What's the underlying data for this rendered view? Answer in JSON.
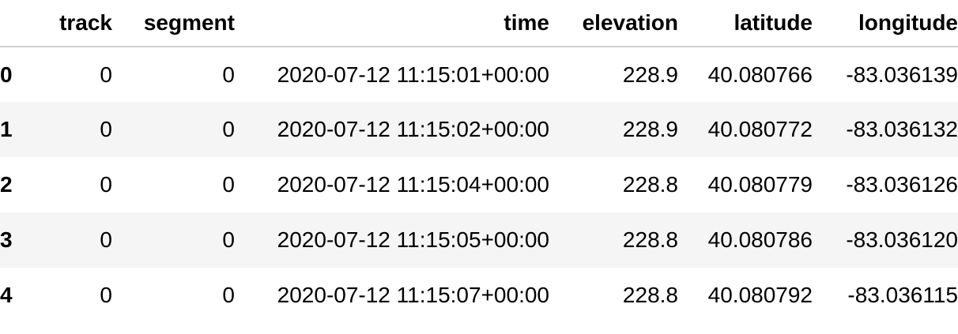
{
  "table": {
    "columns": [
      "",
      "track",
      "segment",
      "time",
      "elevation",
      "latitude",
      "longitude"
    ],
    "rows": [
      {
        "index": "0",
        "track": "0",
        "segment": "0",
        "time": "2020-07-12 11:15:01+00:00",
        "elevation": "228.9",
        "latitude": "40.080766",
        "longitude": "-83.036139"
      },
      {
        "index": "1",
        "track": "0",
        "segment": "0",
        "time": "2020-07-12 11:15:02+00:00",
        "elevation": "228.9",
        "latitude": "40.080772",
        "longitude": "-83.036132"
      },
      {
        "index": "2",
        "track": "0",
        "segment": "0",
        "time": "2020-07-12 11:15:04+00:00",
        "elevation": "228.8",
        "latitude": "40.080779",
        "longitude": "-83.036126"
      },
      {
        "index": "3",
        "track": "0",
        "segment": "0",
        "time": "2020-07-12 11:15:05+00:00",
        "elevation": "228.8",
        "latitude": "40.080786",
        "longitude": "-83.036120"
      },
      {
        "index": "4",
        "track": "0",
        "segment": "0",
        "time": "2020-07-12 11:15:07+00:00",
        "elevation": "228.8",
        "latitude": "40.080792",
        "longitude": "-83.036115"
      }
    ]
  },
  "colors": {
    "stripe": "#f5f5f5",
    "header_border": "#cfcfcf",
    "text": "#000000"
  }
}
